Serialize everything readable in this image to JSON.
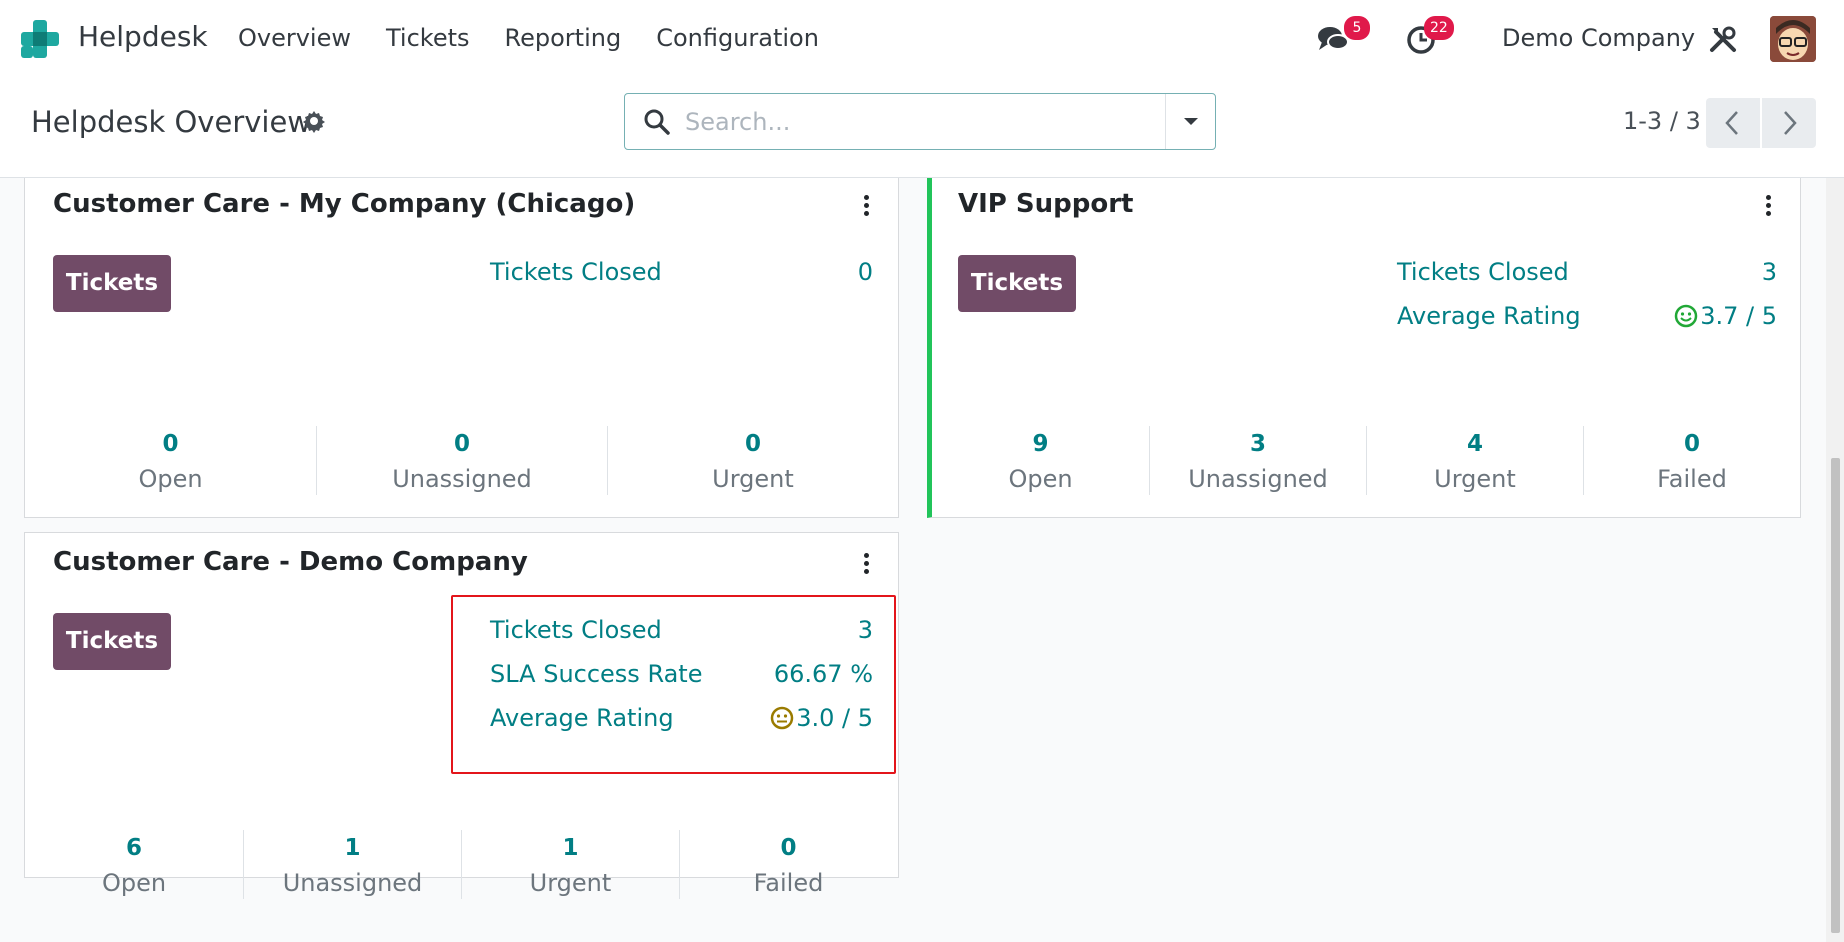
{
  "navbar": {
    "app_name": "Helpdesk",
    "menu": [
      "Overview",
      "Tickets",
      "Reporting",
      "Configuration"
    ],
    "messages_count": "5",
    "activities_count": "22",
    "company": "Demo Company"
  },
  "control": {
    "title": "Helpdesk Overview",
    "search_placeholder": "Search...",
    "pager": "1-3 / 3"
  },
  "teams": [
    {
      "name": "Customer Care - My Company (Chicago)",
      "button": "Tickets",
      "stats": [
        {
          "label": "Tickets Closed",
          "value": "0"
        }
      ],
      "counters": [
        {
          "value": "0",
          "label": "Open"
        },
        {
          "value": "0",
          "label": "Unassigned"
        },
        {
          "value": "0",
          "label": "Urgent"
        }
      ]
    },
    {
      "name": "VIP Support",
      "button": "Tickets",
      "stats": [
        {
          "label": "Tickets Closed",
          "value": "3"
        },
        {
          "label": "Average Rating",
          "value": "3.7 / 5",
          "icon": "smile-icon"
        }
      ],
      "counters": [
        {
          "value": "9",
          "label": "Open"
        },
        {
          "value": "3",
          "label": "Unassigned"
        },
        {
          "value": "4",
          "label": "Urgent"
        },
        {
          "value": "0",
          "label": "Failed"
        }
      ]
    },
    {
      "name": "Customer Care - Demo Company",
      "button": "Tickets",
      "stats": [
        {
          "label": "Tickets Closed",
          "value": "3"
        },
        {
          "label": "SLA Success Rate",
          "value": "66.67 %"
        },
        {
          "label": "Average Rating",
          "value": "3.0 / 5",
          "icon": "neutral-face-icon"
        }
      ],
      "counters": [
        {
          "value": "6",
          "label": "Open"
        },
        {
          "value": "1",
          "label": "Unassigned"
        },
        {
          "value": "1",
          "label": "Urgent"
        },
        {
          "value": "0",
          "label": "Failed"
        }
      ]
    }
  ],
  "colors": {
    "brand": "#714b67",
    "link": "#017e84",
    "vip_border": "#21c45a",
    "badge": "#e0194a",
    "highlight": "#e3151b"
  }
}
